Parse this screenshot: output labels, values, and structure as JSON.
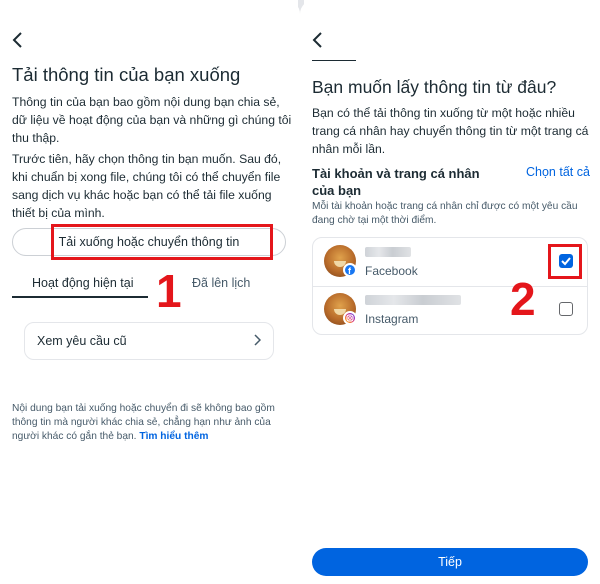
{
  "left_screen": {
    "title": "Tải thông tin của bạn xuống",
    "paragraph_1": "Thông tin của bạn bao gồm nội dung bạn chia sẻ, dữ liệu về hoạt động của bạn và những gì chúng tôi thu thập.",
    "paragraph_2": "Trước tiên, hãy chọn thông tin bạn muốn. Sau đó, khi chuẩn bị xong file, chúng tôi có thể chuyển file sang dịch vụ khác hoặc bạn có thể tải file xuống thiết bị của mình.",
    "primary_button": "Tải xuống hoặc chuyển thông tin",
    "tabs": [
      {
        "label": "Hoạt động hiện tại",
        "active": true
      },
      {
        "label": "Đã lên lịch",
        "active": false
      }
    ],
    "old_requests_button": "Xem yêu cầu cũ",
    "footer_text": "Nội dung bạn tải xuống hoặc chuyển đi sẽ không bao gồm thông tin mà người khác chia sẻ, chẳng hạn như ảnh của người khác có gắn thẻ bạn.",
    "footer_link": "Tìm hiểu thêm",
    "step_number": "1"
  },
  "right_screen": {
    "title": "Bạn muốn lấy thông tin từ đâu?",
    "intro": "Bạn có thể tải thông tin xuống từ một hoặc nhiều trang cá nhân hay chuyển thông tin từ một trang cá nhân mỗi lần.",
    "section_label": "Tài khoản và trang cá nhân của bạn",
    "select_all": "Chọn tất cả",
    "note": "Mỗi tài khoản hoặc trang cá nhân chỉ được có một yêu cầu đang chờ tại một thời điểm.",
    "accounts": [
      {
        "platform": "Facebook",
        "checked": true
      },
      {
        "platform": "Instagram",
        "checked": false
      }
    ],
    "next_button": "Tiếp",
    "step_number": "2"
  },
  "icons": {
    "back": "chevron-left-icon",
    "chevron": "chevron-right-icon",
    "facebook": "facebook-badge-icon",
    "instagram": "instagram-badge-icon",
    "check": "checkmark-icon"
  },
  "colors": {
    "accent": "#0064e0",
    "annotation_red": "#e4161b",
    "text": "#1c2b33",
    "secondary_text": "#465a69"
  }
}
